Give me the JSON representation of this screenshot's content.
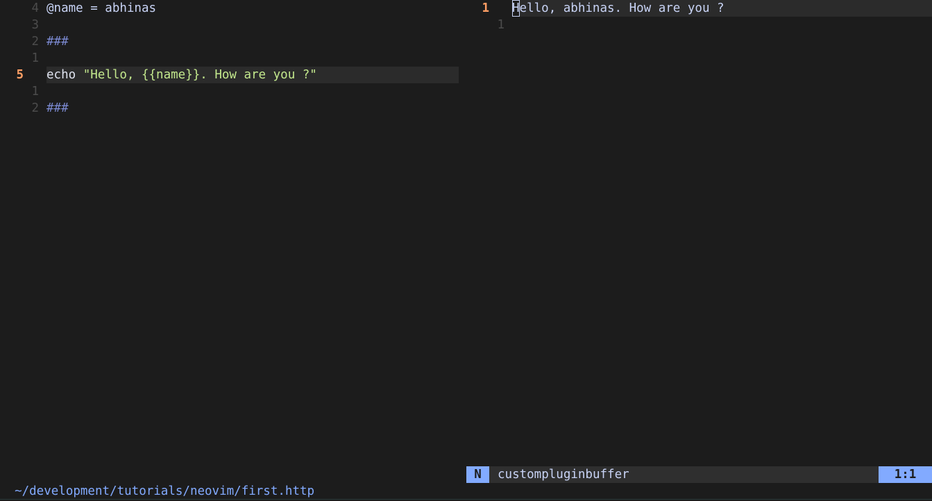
{
  "left_buffer": {
    "lines": [
      {
        "number": "4",
        "current": false,
        "tokens": [
          {
            "cls": "var",
            "text": "@name = abhinas"
          }
        ]
      },
      {
        "number": "3",
        "current": false,
        "tokens": []
      },
      {
        "number": "2",
        "current": false,
        "tokens": [
          {
            "cls": "comment",
            "text": "###"
          }
        ]
      },
      {
        "number": "1",
        "current": false,
        "tokens": []
      },
      {
        "number": "5",
        "current": true,
        "tokens": [
          {
            "cls": "kw",
            "text": "echo "
          },
          {
            "cls": "str",
            "text": "\"Hello, {{name}}. How are you ?\""
          }
        ]
      },
      {
        "number": "1",
        "current": false,
        "tokens": []
      },
      {
        "number": "2",
        "current": false,
        "tokens": [
          {
            "cls": "comment",
            "text": "###"
          }
        ]
      }
    ]
  },
  "right_buffer": {
    "lines": [
      {
        "number": "1",
        "current": true,
        "cursor_char": "H",
        "text": "ello, abhinas. How are you ?"
      },
      {
        "number": "1",
        "current": false,
        "cursor_char": "",
        "text": ""
      }
    ]
  },
  "statusline": {
    "left_path": "~/development/tutorials/neovim/first.http",
    "mode": "N",
    "buffer_name": "custompluginbuffer",
    "position": "1:1"
  },
  "colors": {
    "background": "#1c1c1c",
    "accent": "#82aaff",
    "line_number_current": "#ff9e64",
    "string": "#c3e88d",
    "comment": "#7a88cf"
  }
}
